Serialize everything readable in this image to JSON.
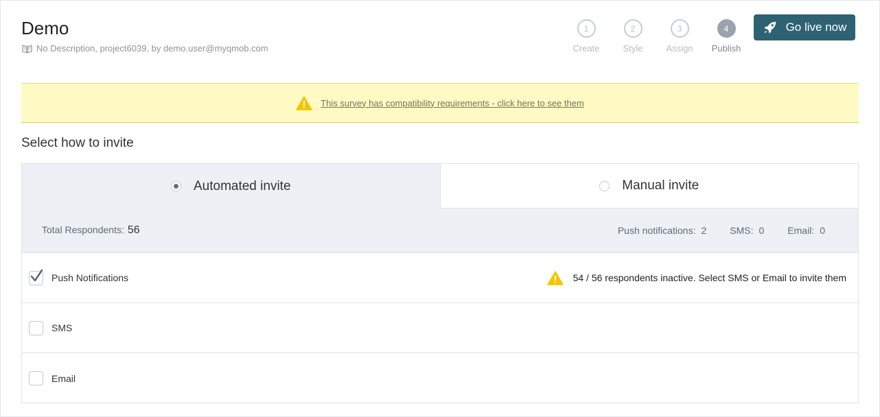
{
  "header": {
    "title": "Demo",
    "description": "No Description, project6039, by demo.user@myqmob.com",
    "go_live_label": "Go live now"
  },
  "steps": [
    {
      "number": "1",
      "label": "Create",
      "active": false
    },
    {
      "number": "2",
      "label": "Style",
      "active": false
    },
    {
      "number": "3",
      "label": "Assign",
      "active": false
    },
    {
      "number": "4",
      "label": "Publish",
      "active": true
    }
  ],
  "banner": {
    "text": "This survey has compatibility requirements - click here to see them"
  },
  "section_title": "Select how to invite",
  "tabs": {
    "automated": "Automated invite",
    "manual": "Manual invite",
    "selected": "automated"
  },
  "summary": {
    "total_label": "Total Respondents:",
    "total_value": "56",
    "push_label": "Push notifications:",
    "push_value": "2",
    "sms_label": "SMS:",
    "sms_value": "0",
    "email_label": "Email:",
    "email_value": "0"
  },
  "channels": [
    {
      "label": "Push Notifications",
      "checked": true,
      "warning": "54 / 56 respondents inactive. Select SMS or Email to invite them"
    },
    {
      "label": "SMS",
      "checked": false
    },
    {
      "label": "Email",
      "checked": false
    }
  ],
  "colors": {
    "primary_button": "#2e6272",
    "banner_bg": "#fffac4",
    "warning_icon": "#f5c400"
  }
}
